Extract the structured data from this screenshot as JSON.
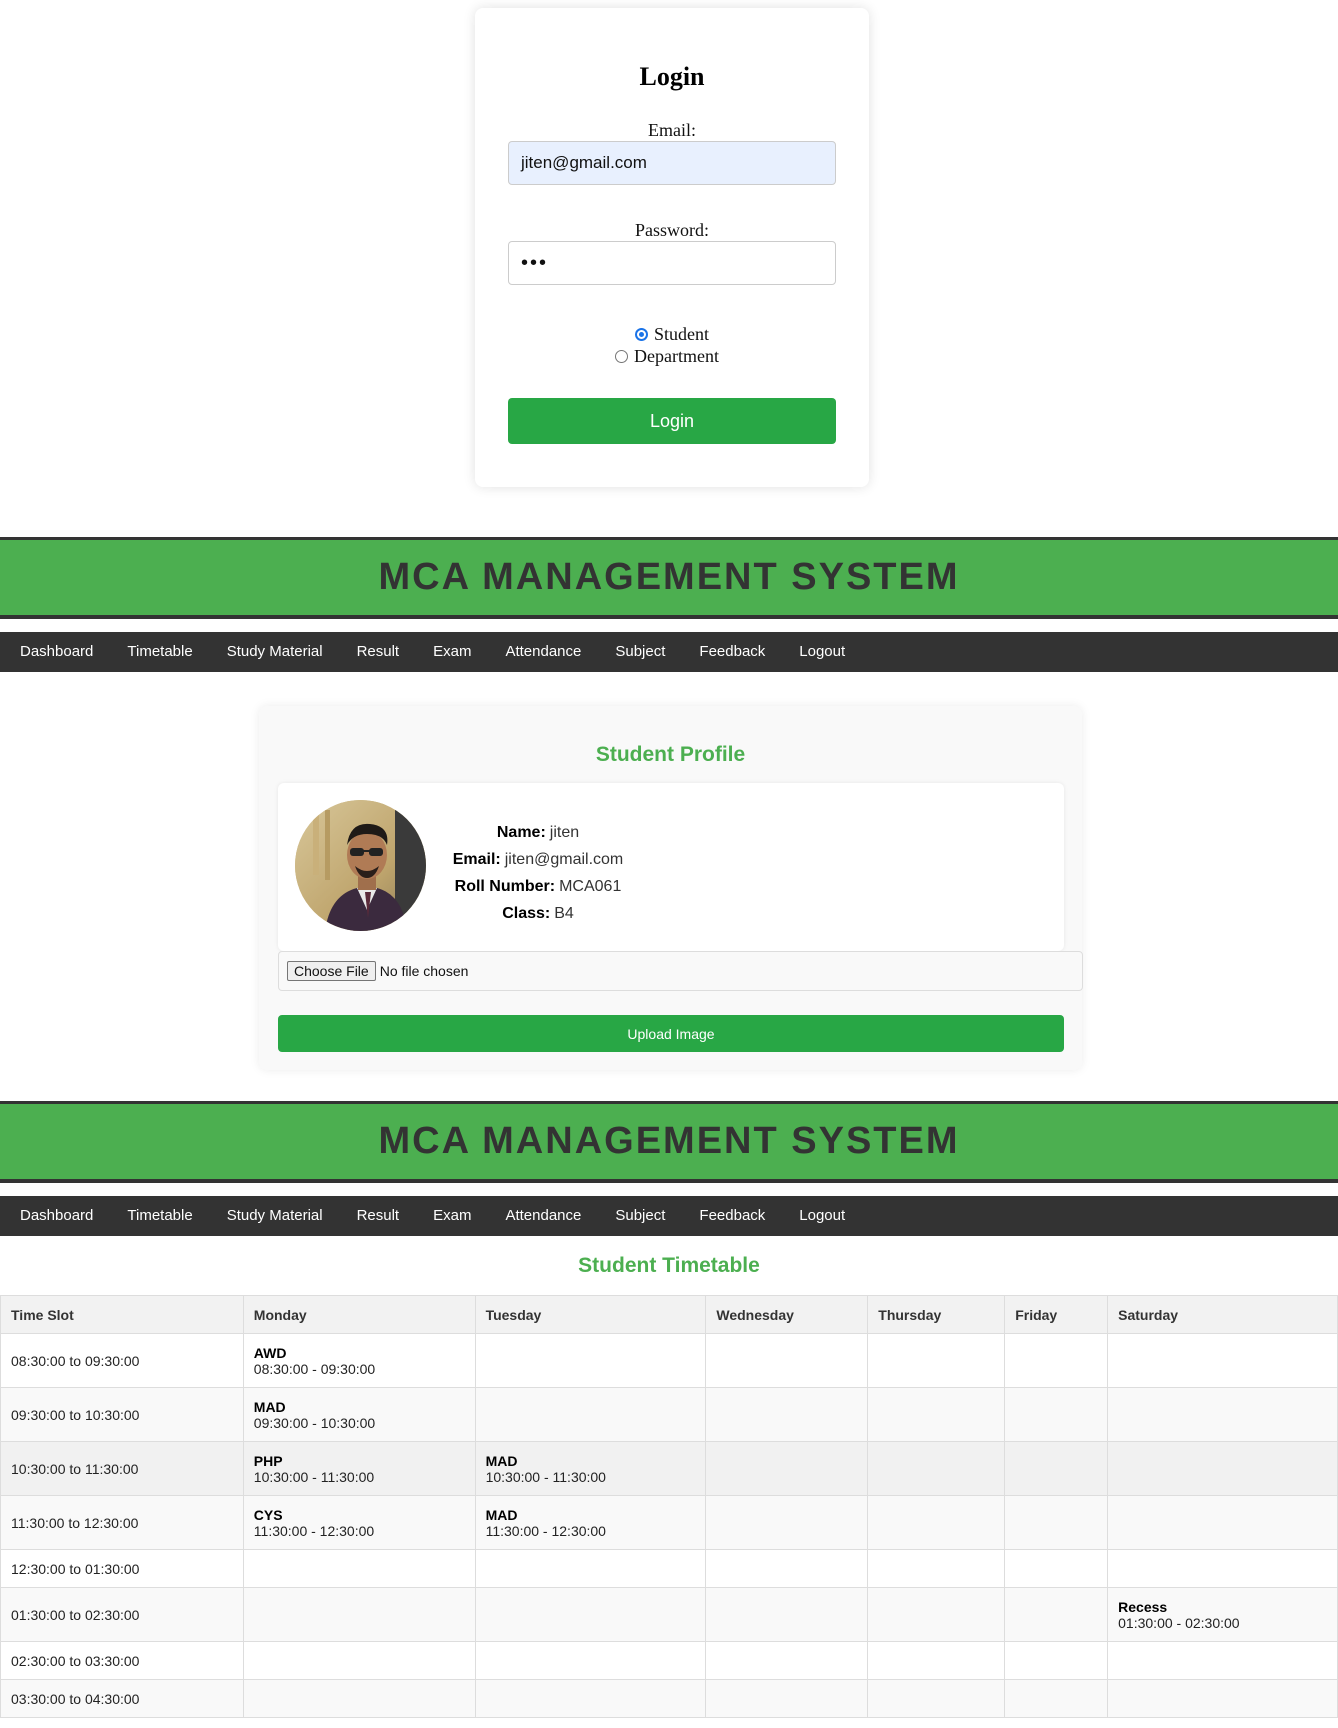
{
  "login": {
    "title": "Login",
    "email_label": "Email:",
    "email_value": "jiten@gmail.com",
    "password_label": "Password:",
    "password_masked": "•••",
    "roles": [
      {
        "label": "Student",
        "checked": true
      },
      {
        "label": "Department",
        "checked": false
      }
    ],
    "button": "Login"
  },
  "header": {
    "title": "MCA MANAGEMENT SYSTEM",
    "bg_color": "#4caf50"
  },
  "nav": {
    "items": [
      "Dashboard",
      "Timetable",
      "Study Material",
      "Result",
      "Exam",
      "Attendance",
      "Subject",
      "Feedback",
      "Logout"
    ]
  },
  "profile": {
    "title": "Student Profile",
    "name_label": "Name:",
    "name": "jiten",
    "email_label": "Email:",
    "email": "jiten@gmail.com",
    "roll_label": "Roll Number:",
    "roll": "MCA061",
    "class_label": "Class:",
    "class": "B4",
    "choose_file": "Choose File",
    "no_file": "No file chosen",
    "upload_button": "Upload Image"
  },
  "timetable": {
    "title": "Student Timetable",
    "headers": [
      "Time Slot",
      "Monday",
      "Tuesday",
      "Wednesday",
      "Thursday",
      "Friday",
      "Saturday"
    ],
    "rows": [
      {
        "slot": "08:30:00 to 09:30:00",
        "cells": [
          {
            "subject": "AWD",
            "time": "08:30:00 - 09:30:00"
          },
          null,
          null,
          null,
          null,
          null
        ]
      },
      {
        "slot": "09:30:00 to 10:30:00",
        "cells": [
          {
            "subject": "MAD",
            "time": "09:30:00 - 10:30:00"
          },
          null,
          null,
          null,
          null,
          null
        ]
      },
      {
        "slot": "10:30:00 to 11:30:00",
        "cells": [
          {
            "subject": "PHP",
            "time": "10:30:00 - 11:30:00"
          },
          {
            "subject": "MAD",
            "time": "10:30:00 - 11:30:00"
          },
          null,
          null,
          null,
          null
        ]
      },
      {
        "slot": "11:30:00 to 12:30:00",
        "cells": [
          {
            "subject": "CYS",
            "time": "11:30:00 - 12:30:00"
          },
          {
            "subject": "MAD",
            "time": "11:30:00 - 12:30:00"
          },
          null,
          null,
          null,
          null
        ]
      },
      {
        "slot": "12:30:00 to 01:30:00",
        "cells": [
          null,
          null,
          null,
          null,
          null,
          null
        ]
      },
      {
        "slot": "01:30:00 to 02:30:00",
        "cells": [
          null,
          null,
          null,
          null,
          null,
          {
            "subject": "Recess",
            "time": "01:30:00 - 02:30:00"
          }
        ]
      },
      {
        "slot": "02:30:00 to 03:30:00",
        "cells": [
          null,
          null,
          null,
          null,
          null,
          null
        ]
      },
      {
        "slot": "03:30:00 to 04:30:00",
        "cells": [
          null,
          null,
          null,
          null,
          null,
          null
        ]
      }
    ]
  }
}
